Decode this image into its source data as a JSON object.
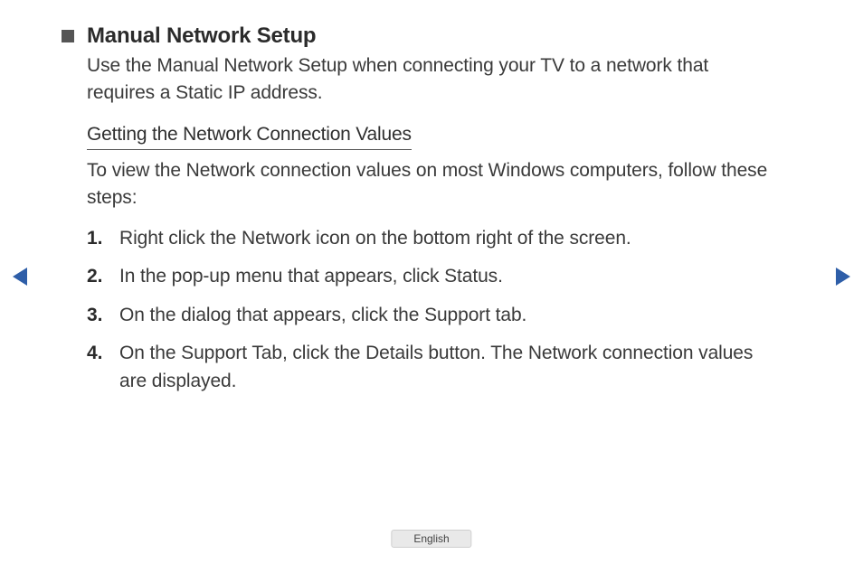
{
  "heading": "Manual Network Setup",
  "intro": "Use the Manual Network Setup when connecting your TV to a network that requires a Static IP address.",
  "subheading": "Getting the Network Connection Values",
  "sub_intro": "To view the Network connection values on most Windows computers, follow these steps:",
  "steps": [
    {
      "num": "1.",
      "text": "Right click the Network icon on the bottom right of the screen."
    },
    {
      "num": "2.",
      "text": "In the pop-up menu that appears, click Status."
    },
    {
      "num": "3.",
      "text": "On the dialog that appears, click the Support tab."
    },
    {
      "num": "4.",
      "text": "On the Support Tab, click the Details button. The Network connection values are displayed."
    }
  ],
  "language": "English"
}
